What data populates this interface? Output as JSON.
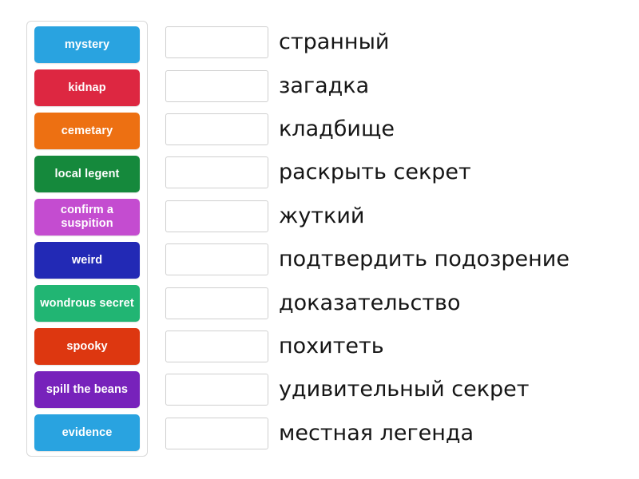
{
  "activity": {
    "type": "match-up",
    "tiles_panel_name": "word-tiles-panel"
  },
  "tiles": [
    {
      "label": "mystery",
      "color": "#29a3e0"
    },
    {
      "label": "kidnap",
      "color": "#dd2741"
    },
    {
      "label": "cemetary",
      "color": "#ed7012"
    },
    {
      "label": "local legent",
      "color": "#15893c"
    },
    {
      "label": "confirm a suspition",
      "color": "#c44cd0"
    },
    {
      "label": "weird",
      "color": "#2229b5"
    },
    {
      "label": "wondrous secret",
      "color": "#21b573"
    },
    {
      "label": "spooky",
      "color": "#dd3710"
    },
    {
      "label": "spill the beans",
      "color": "#7722bb"
    },
    {
      "label": "evidence",
      "color": "#29a3e0"
    }
  ],
  "rows": [
    {
      "answer": "странный",
      "dropped_value": ""
    },
    {
      "answer": "загадка",
      "dropped_value": ""
    },
    {
      "answer": "кладбище",
      "dropped_value": ""
    },
    {
      "answer": "раскрыть секрет",
      "dropped_value": ""
    },
    {
      "answer": "жуткий",
      "dropped_value": ""
    },
    {
      "answer": "подтвердить подозрение",
      "dropped_value": ""
    },
    {
      "answer": "доказательство",
      "dropped_value": ""
    },
    {
      "answer": "похитеть",
      "dropped_value": ""
    },
    {
      "answer": "удивительный секрет",
      "dropped_value": ""
    },
    {
      "answer": "местная легенда",
      "dropped_value": ""
    }
  ],
  "colors": {
    "page_background": "#ffffff",
    "panel_border": "#d8d8d8",
    "dropbox_border": "#cfcfcf",
    "answer_text": "#161616",
    "tile_text": "#ffffff"
  }
}
